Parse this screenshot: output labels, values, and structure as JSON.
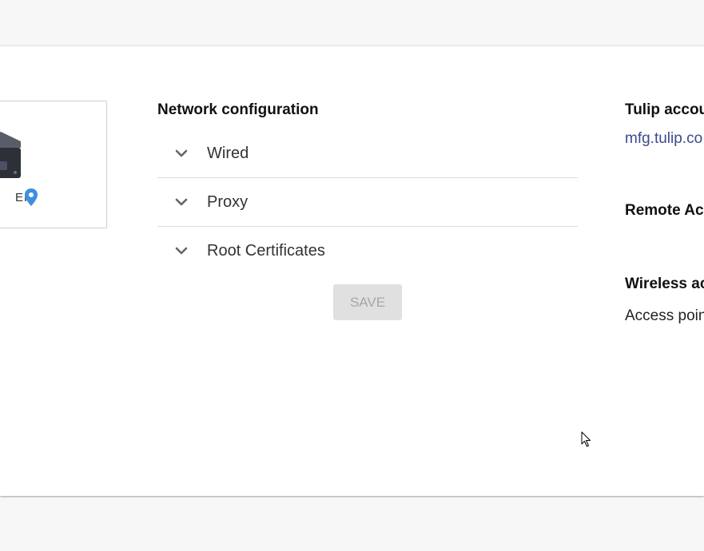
{
  "device": {
    "name_partial": "EF",
    "image_icon": "edge-device-icon",
    "location_icon": "location-pin-icon",
    "location_icon_color": "#3d8fe0"
  },
  "network": {
    "title": "Network configuration",
    "sections": [
      {
        "label": "Wired",
        "icon": "chevron-down-icon"
      },
      {
        "label": "Proxy",
        "icon": "chevron-down-icon"
      },
      {
        "label": "Root Certificates",
        "icon": "chevron-down-icon"
      }
    ],
    "save_label": "SAVE"
  },
  "right_column": {
    "account_heading": "Tulip account",
    "account_link": "mfg.tulip.co",
    "remote_heading": "Remote Access",
    "wireless_heading": "Wireless access point",
    "access_point_text": "Access point"
  },
  "colors": {
    "link": "#3c4a8c",
    "save_disabled_bg": "#e0e0e0",
    "save_disabled_text": "#a6a6a6"
  }
}
